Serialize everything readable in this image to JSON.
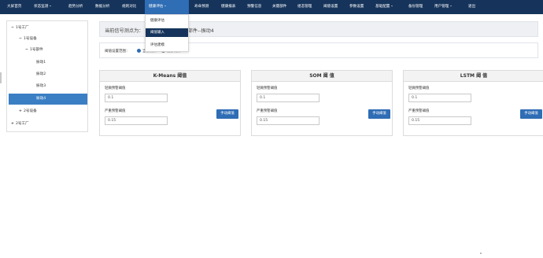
{
  "nav": {
    "items": [
      {
        "label": "大屏首页"
      },
      {
        "label": "状态监测",
        "dropdown": true
      },
      {
        "label": "趋势分析"
      },
      {
        "label": "数据分析"
      },
      {
        "label": "规则对比"
      },
      {
        "label": "健康评估",
        "dropdown": true,
        "active": true
      },
      {
        "label": "寿命预测"
      },
      {
        "label": "健康报表"
      },
      {
        "label": "预警信息"
      },
      {
        "label": "关键部件"
      },
      {
        "label": "组态管理"
      },
      {
        "label": "阈值设置"
      },
      {
        "label": "参数设置"
      },
      {
        "label": "基础配置",
        "dropdown": true
      },
      {
        "label": "备份管理"
      },
      {
        "label": "用户管理",
        "dropdown": true
      },
      {
        "label": "退出"
      }
    ],
    "colors": {
      "bar": "#16345b",
      "active": "#2f6db5"
    }
  },
  "dropdown": {
    "items": [
      {
        "label": "健康评估"
      },
      {
        "label": "阈值输入",
        "active": true
      },
      {
        "label": "评估建模"
      }
    ]
  },
  "tree": {
    "nodes": [
      {
        "label": "1号工厂",
        "glyph": "−"
      },
      {
        "label": "1号设备",
        "glyph": "−"
      },
      {
        "label": "1号部件",
        "glyph": "−"
      },
      {
        "label": "振动1",
        "glyph": ""
      },
      {
        "label": "振动2",
        "glyph": ""
      },
      {
        "label": "振动3",
        "glyph": ""
      },
      {
        "label": "振动4",
        "glyph": "",
        "selected": true
      },
      {
        "label": "2号设备",
        "glyph": "+"
      },
      {
        "label": "2号工厂",
        "glyph": "+"
      }
    ]
  },
  "info": {
    "text_prefix": "当前信号测点为：",
    "text_suffix": "1号部件--振动4"
  },
  "range": {
    "label": "阈值设置范围：",
    "options": [
      {
        "label": "当前测点",
        "checked": true
      },
      {
        "label": "全部测点",
        "checked": false
      }
    ]
  },
  "panels": [
    {
      "title": "K-Means 阈值",
      "warn_label": "轻微预警阈值",
      "warn_value": "0.1",
      "severe_label": "严重预警阈值",
      "severe_value": "0.15",
      "button": "手动阈值"
    },
    {
      "title": "SOM 阈 值",
      "warn_label": "轻微预警阈值",
      "warn_value": "0.1",
      "severe_label": "严重预警阈值",
      "severe_value": "0.15",
      "button": "手动阈值"
    },
    {
      "title": "LSTM 阈 值",
      "warn_label": "轻微预警阈值",
      "warn_value": "0.1",
      "severe_label": "严重预警阈值",
      "severe_value": "0.15",
      "button": "手动阈值"
    }
  ]
}
